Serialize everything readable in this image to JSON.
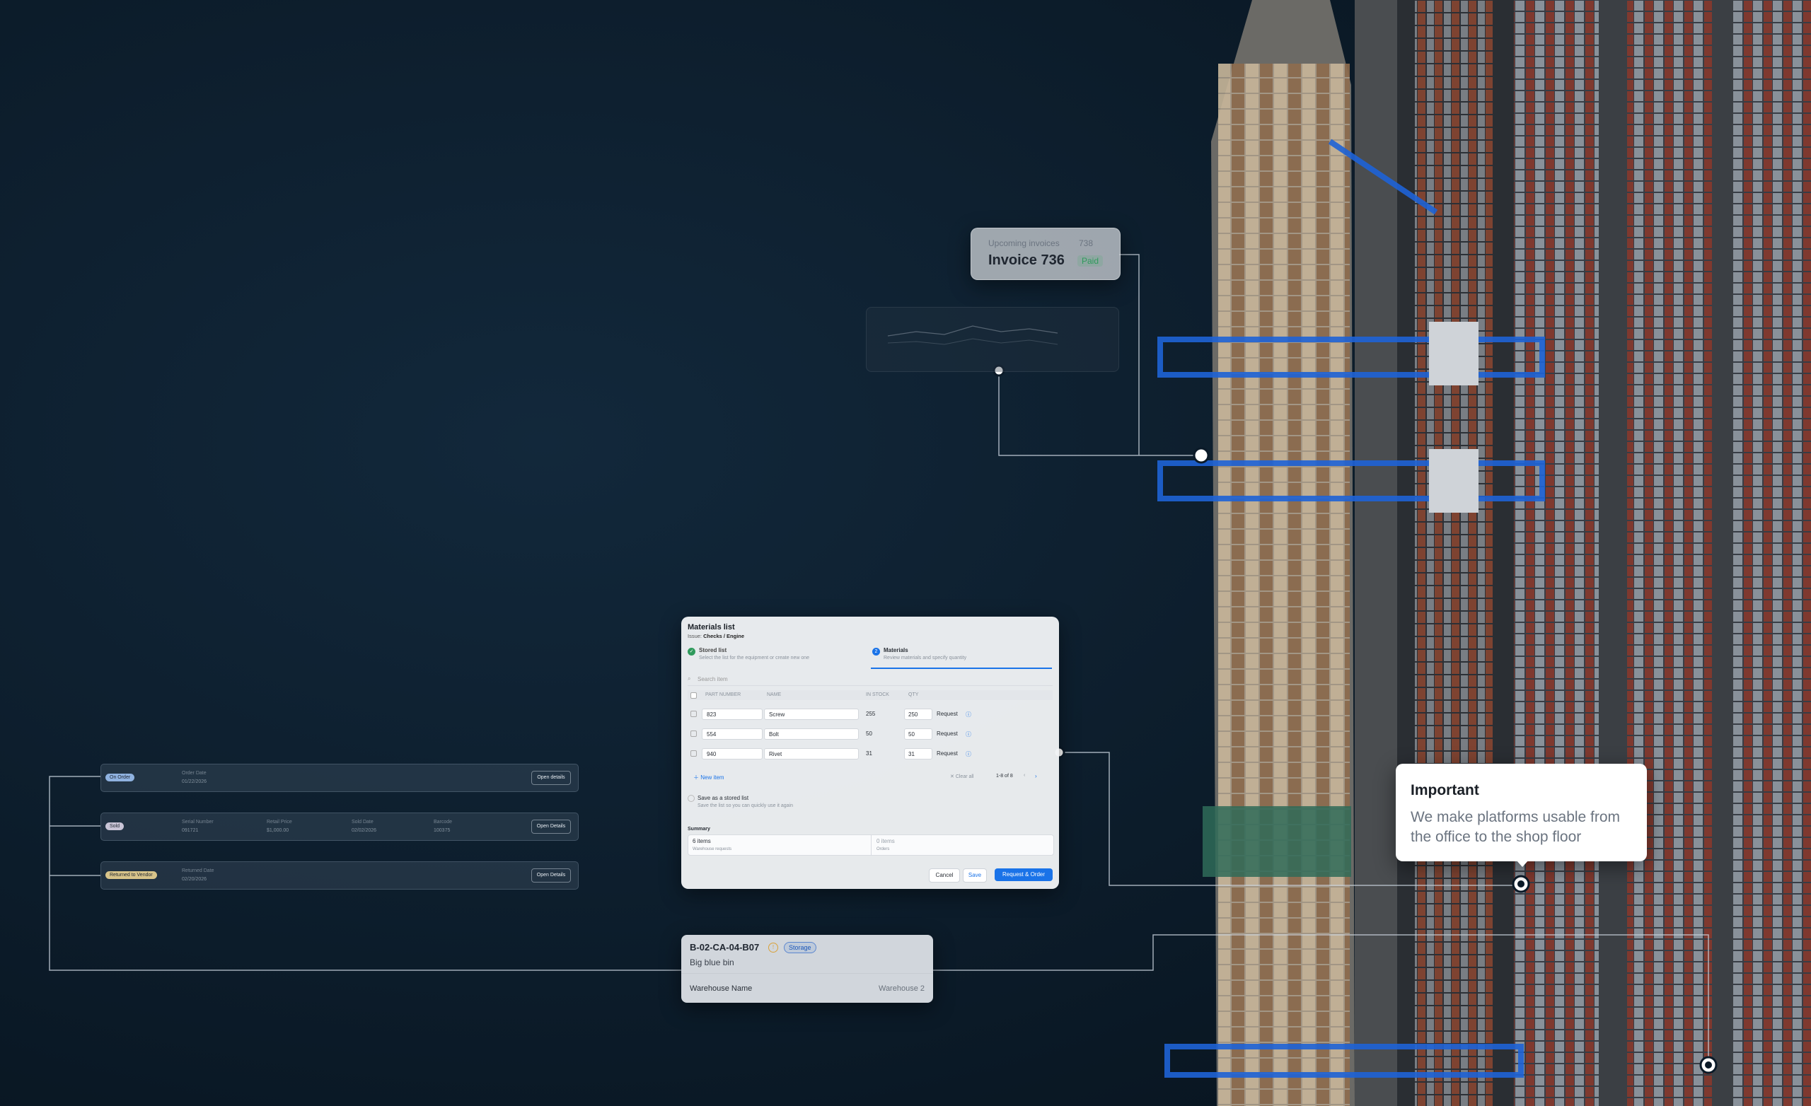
{
  "invoice": {
    "label": "Upcoming invoices",
    "count": "738",
    "title": "Invoice 736",
    "status": "Paid"
  },
  "materials": {
    "title": "Materials list",
    "issue_prefix": "Issue:",
    "issue": "Checks / Engine",
    "steps": [
      {
        "label": "Stored list",
        "desc": "Select the list for the equipment or create new one",
        "state": "done"
      },
      {
        "label": "Materials",
        "desc": "Review materials and specify quantity",
        "state": "active",
        "number": "2"
      }
    ],
    "search_placeholder": "Search item",
    "columns": [
      "PART NUMBER",
      "NAME",
      "IN STOCK",
      "QTY"
    ],
    "rows": [
      {
        "part": "823",
        "name": "Screw",
        "stock": "255",
        "qty": "250",
        "action": "Request"
      },
      {
        "part": "554",
        "name": "Bolt",
        "stock": "50",
        "qty": "50",
        "action": "Request"
      },
      {
        "part": "940",
        "name": "Rivet",
        "stock": "31",
        "qty": "31",
        "action": "Request"
      }
    ],
    "new_item": "New item",
    "clear_all": "Clear all",
    "pagination": "1-8 of 8",
    "save_stored_label": "Save as a stored list",
    "save_stored_desc": "Save the list so you can quickly use it again",
    "summary_title": "Summary",
    "summary": [
      {
        "value": "6 items",
        "label": "Warehouse requests"
      },
      {
        "value": "0 items",
        "label": "Orders"
      }
    ],
    "cancel": "Cancel",
    "save": "Save",
    "request_order": "Request & Order"
  },
  "order_rows": [
    {
      "badge": "On Order",
      "badge_color": "#8fb2e0",
      "fields": [
        {
          "label": "Order Date",
          "value": "01/22/2026"
        }
      ],
      "button": "Open details"
    },
    {
      "badge": "Sold",
      "badge_color": "#c9c4d6",
      "fields": [
        {
          "label": "Serial Number",
          "value": "091721"
        },
        {
          "label": "Retail Price",
          "value": "$1,000.00"
        },
        {
          "label": "Sold Date",
          "value": "02/02/2026"
        },
        {
          "label": "Barcode",
          "value": "100375"
        }
      ],
      "button": "Open Details"
    },
    {
      "badge": "Returned to Vendor",
      "badge_color": "#d8c48a",
      "fields": [
        {
          "label": "Returned Date",
          "value": "02/20/2026"
        }
      ],
      "button": "Open Details"
    }
  ],
  "bin": {
    "code": "B-02-CA-04-B07",
    "tag": "Storage",
    "name": "Big blue bin",
    "field_label": "Warehouse Name",
    "field_value": "Warehouse 2"
  },
  "important": {
    "title": "Important",
    "text": "We make platforms usable from the office to the shop floor"
  },
  "colors": {
    "ocean": "#0b1a28",
    "accent_blue": "#1a73e8",
    "success_green": "#2f9a5c",
    "connector_line": "#c8d2dc"
  }
}
